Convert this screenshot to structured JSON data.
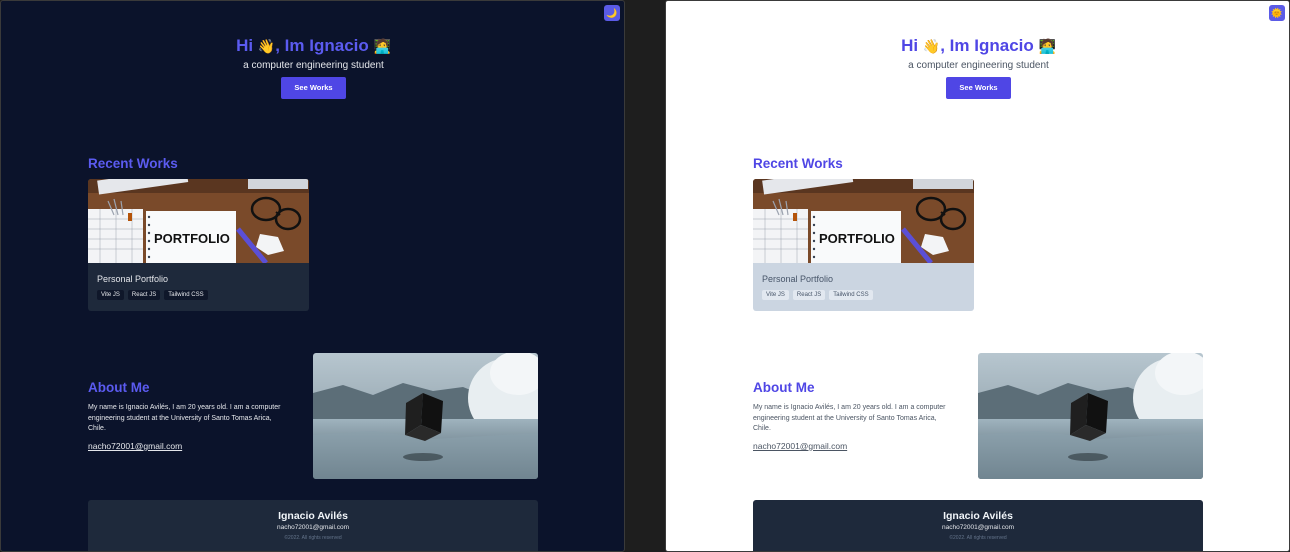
{
  "hero": {
    "greeting": "Hi",
    "wave_emoji": "👋",
    "name": ", Im Ignacio",
    "tech_emoji": "🧑‍💻",
    "subtitle": "a computer engineering student",
    "button_label": "See Works"
  },
  "theme_toggle": {
    "dark_icon": "🌙",
    "light_icon": "🌞"
  },
  "recent_works": {
    "title": "Recent Works",
    "cards": [
      {
        "image_text": "PORTFOLIO",
        "title": "Personal Portfolio",
        "tags": [
          "Vite JS",
          "React JS",
          "Tailwind CSS"
        ]
      }
    ]
  },
  "about": {
    "title": "About Me",
    "text": "My name is Ignacio Avilés, I am 20 years old. I am a computer engineering student at the University of Santo Tomas Arica, Chile.",
    "email": "nacho72001@gmail.com"
  },
  "footer": {
    "name": "Ignacio Avilés",
    "email": "nacho72001@gmail.com",
    "copyright": "©2022. All rights reserved"
  },
  "colors": {
    "accent": "#4f46e5",
    "dark_bg": "#0b132b",
    "card_dark": "#1e293b",
    "card_light": "#cbd5e1"
  }
}
